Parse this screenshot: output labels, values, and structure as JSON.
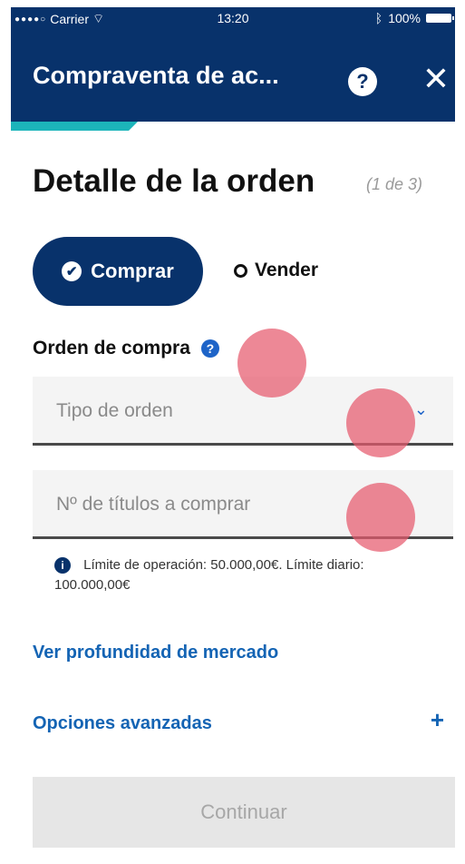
{
  "status_bar": {
    "carrier": "Carrier",
    "time": "13:20",
    "battery": "100%"
  },
  "header": {
    "title": "Compraventa de ac...",
    "help_icon": "?",
    "close_icon": "✕"
  },
  "page": {
    "title": "Detalle de la orden",
    "step": "(1 de 3)"
  },
  "toggle": {
    "buy": "Comprar",
    "sell": "Vender",
    "selected": "buy"
  },
  "order": {
    "label": "Orden de compra",
    "type_placeholder": "Tipo de orden",
    "qty_placeholder": "Nº de títulos a comprar",
    "info_note": "Límite de operación: 50.000,00€. Límite diario: 100.000,00€"
  },
  "links": {
    "depth": "Ver profundidad de mercado",
    "advanced": "Opciones avanzadas",
    "advanced_icon": "+"
  },
  "continue_label": "Continuar",
  "colors": {
    "primary": "#08326b",
    "accent": "#1cb4ba",
    "link": "#1464b4"
  }
}
